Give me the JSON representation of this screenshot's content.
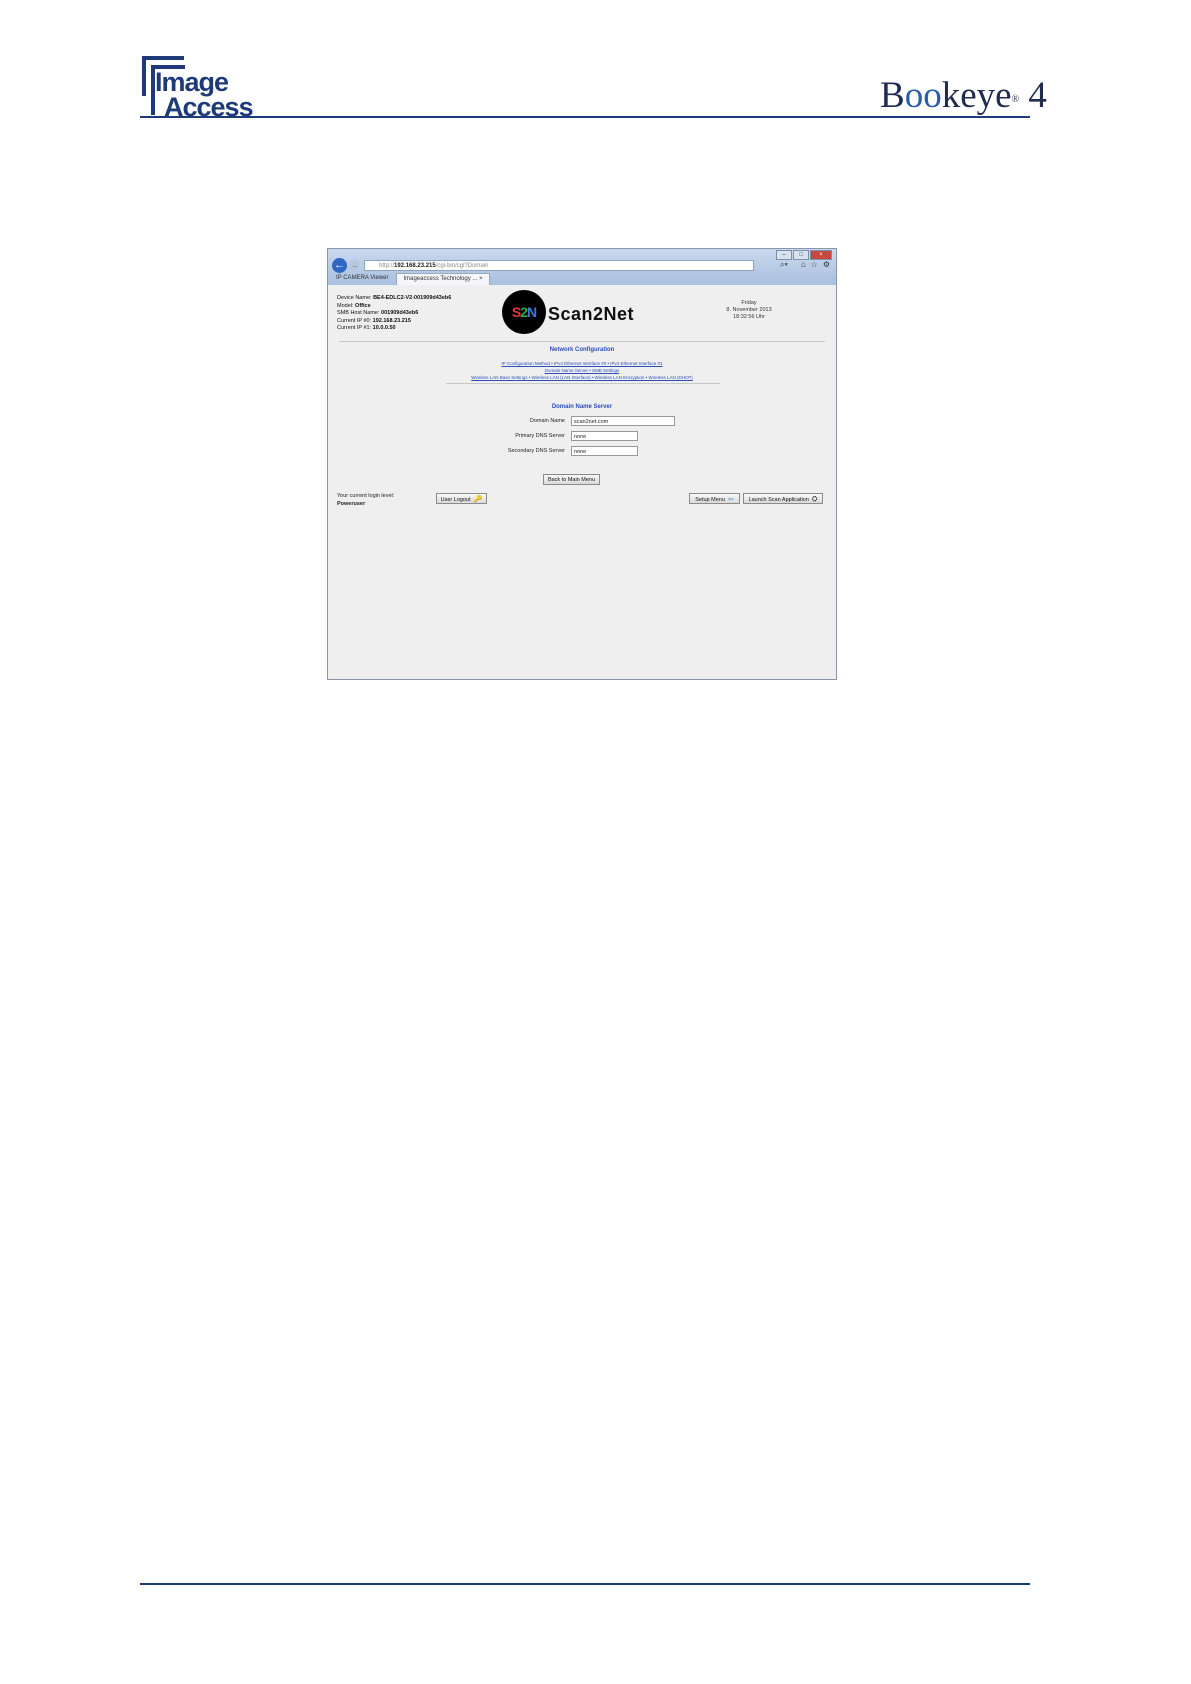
{
  "header": {
    "logo_line1": "Image",
    "logo_line2": "Access",
    "product_pre": "B",
    "product_oo": "oo",
    "product_post": "keye",
    "product_reg": "®",
    "product_num": " 4"
  },
  "browser": {
    "address_scheme": "http://",
    "address_host": "192.168.23.215",
    "address_path": "/cgi-bin/cgi?Domain",
    "tabs": [
      "IP CAMERA Viewer",
      "Imageaccess Technology ... ×"
    ],
    "icons": {
      "back": "back-arrow-icon",
      "forward": "forward-arrow-icon",
      "search": "search-icon",
      "home": "home-icon",
      "favorites": "star-icon",
      "tools": "gear-icon"
    }
  },
  "device": {
    "name_label": "Device Name:",
    "name_value": "BE4-EDLC2-V2-001909d43eb6",
    "model_label": "Model:",
    "model_value": "Office",
    "smb_label": "SMB Host Name:",
    "smb_value": "001909d43eb6",
    "ip0_label": "Current IP #0:",
    "ip0_value": "192.168.23.215",
    "ip1_label": "Current IP #1:",
    "ip1_value": "10.0.0.50"
  },
  "logo": {
    "circle_s": "S",
    "circle_2": "2",
    "circle_n": "N",
    "word": "Scan2Net"
  },
  "date": {
    "day": "Friday",
    "date": "8. November 2013",
    "time": "18:32:56 Uhr"
  },
  "network": {
    "title": "Network Configuration",
    "links_row1": "IP Configuration Method • IPv4 Ethernet Interface #0 • IPv4 Ethernet Interface #1",
    "links_row2": "Domain Name Server • SMB Settings",
    "links_row3": "Wireless LAN Base Settings • Wireless LAN (LAN Interface) • Wireless LAN Encryption • Wireless LAN (DHCP)"
  },
  "dns": {
    "title": "Domain Name Server",
    "domain_label": "Domain Name",
    "domain_value": "scan2net.com",
    "primary_label": "Primary DNS Server",
    "primary_value": "none",
    "secondary_label": "Secondary DNS Server",
    "secondary_value": "none"
  },
  "buttons": {
    "back_main": "Back to Main Menu",
    "logout": "User Logout",
    "setup": "Setup Menu",
    "launch": "Launch Scan Application"
  },
  "login": {
    "label": "Your current login level:",
    "level": "Poweruser"
  }
}
